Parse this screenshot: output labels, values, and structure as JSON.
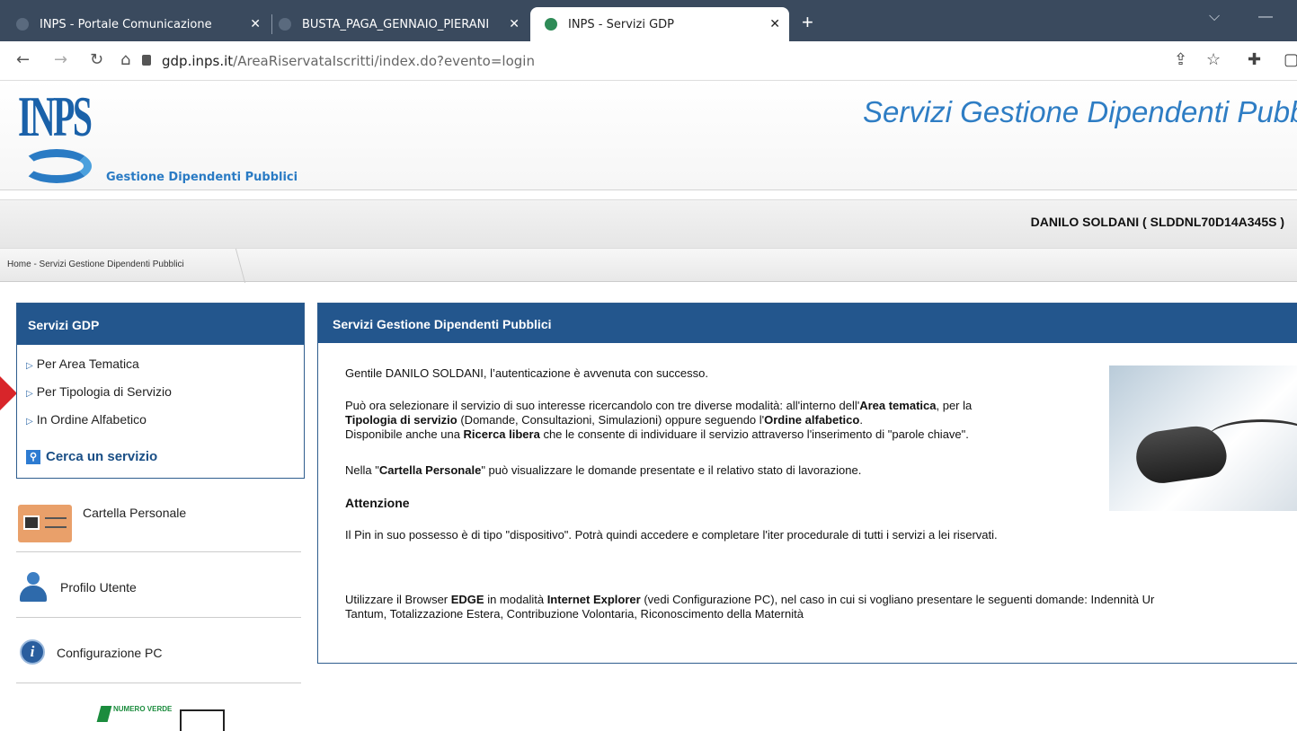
{
  "browser": {
    "tabs": [
      {
        "label": "INPS - Portale Comunicazione",
        "active": false
      },
      {
        "label": "BUSTA_PAGA_GENNAIO_PIERANI",
        "active": false
      },
      {
        "label": "INPS - Servizi GDP",
        "active": true
      }
    ],
    "url_domain": "gdp.inps.it",
    "url_path": "/AreaRiservataIscritti/index.do?evento=login"
  },
  "header": {
    "logo_text": "INPS",
    "logo_subtitle": "Gestione Dipendenti Pubblici",
    "site_title": "Servizi Gestione Dipendenti Pubb"
  },
  "user": {
    "name": "DANILO SOLDANI ( SLDDNL70D14A345S )"
  },
  "breadcrumb": "Home - Servizi Gestione Dipendenti Pubblici",
  "sidebar": {
    "title": "Servizi GDP",
    "links": [
      "Per Area Tematica",
      "Per Tipologia di Servizio",
      "In Ordine Alfabetico"
    ],
    "search": "Cerca un servizio",
    "items": [
      "Cartella Personale",
      "Profilo Utente",
      "Configurazione PC"
    ],
    "numero_verde": "NUMERO VERDE"
  },
  "main": {
    "title": "Servizi Gestione Dipendenti Pubblici",
    "greeting": "Gentile DANILO SOLDANI, l’autenticazione è avvenuta con successo.",
    "p1_a": "Può ora selezionare il servizio di suo interesse ricercandolo con tre diverse modalità: all'interno dell'",
    "p1_b": "Area tematica",
    "p1_c": ", per la",
    "p1_d": "Tipologia di servizio",
    "p1_e": " (Domande, Consultazioni, Simulazioni) oppure seguendo l'",
    "p1_f": "Ordine alfabetico",
    "p1_g": ".",
    "p2_a": "Disponibile anche una ",
    "p2_b": "Ricerca libera",
    "p2_c": " che le consente di individuare il servizio attraverso l'inserimento di \"parole chiave\".",
    "p3_a": "Nella \"",
    "p3_b": "Cartella Personale",
    "p3_c": "\" può visualizzare le domande presentate e il relativo stato di lavorazione.",
    "attention_title": "Attenzione",
    "attention_text": "Il Pin in suo possesso è di tipo \"dispositivo\". Potrà quindi accedere e completare l'iter procedurale di tutti i servizi a lei riservati.",
    "p4_a": "Utilizzare il Browser ",
    "p4_b": "EDGE",
    "p4_c": " in modalità ",
    "p4_d": "Internet Explorer",
    "p4_e": " (vedi Configurazione PC), nel caso in cui si vogliano presentare le seguenti domande: Indennità Ur",
    "p4_f": "Tantum, Totalizzazione Estera, Contribuzione Volontaria, Riconoscimento della Maternità"
  }
}
